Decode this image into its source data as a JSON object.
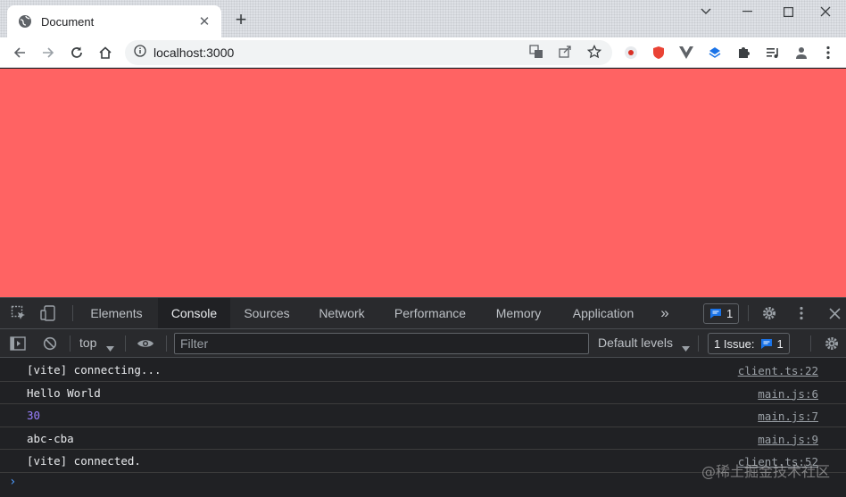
{
  "window": {
    "tab_title": "Document",
    "new_tab_symbol": "+",
    "close_tab_symbol": "✕"
  },
  "toolbar": {
    "url": "localhost:3000"
  },
  "page": {
    "background_color": "#ff6363"
  },
  "devtools": {
    "tabs": [
      {
        "label": "Elements"
      },
      {
        "label": "Console"
      },
      {
        "label": "Sources"
      },
      {
        "label": "Network"
      },
      {
        "label": "Performance"
      },
      {
        "label": "Memory"
      },
      {
        "label": "Application"
      }
    ],
    "active_tab": "Console",
    "more_tabs_symbol": "»",
    "messages_count": "1",
    "context": "top",
    "filter_placeholder": "Filter",
    "levels_label": "Default levels",
    "issues_label": "1 Issue:",
    "issues_count": "1",
    "accent_color": "#4d9cff"
  },
  "console": {
    "logs": [
      {
        "message": "[vite] connecting...",
        "source": "client.ts:22"
      },
      {
        "message": "Hello World",
        "source": "main.js:6"
      },
      {
        "message": "30",
        "source": "main.js:7"
      },
      {
        "message": "abc-cba",
        "source": "main.js:9"
      },
      {
        "message": "[vite] connected.",
        "source": "client.ts:52"
      }
    ],
    "prompt_symbol": "›"
  },
  "watermark": "@稀土掘金技术社区"
}
